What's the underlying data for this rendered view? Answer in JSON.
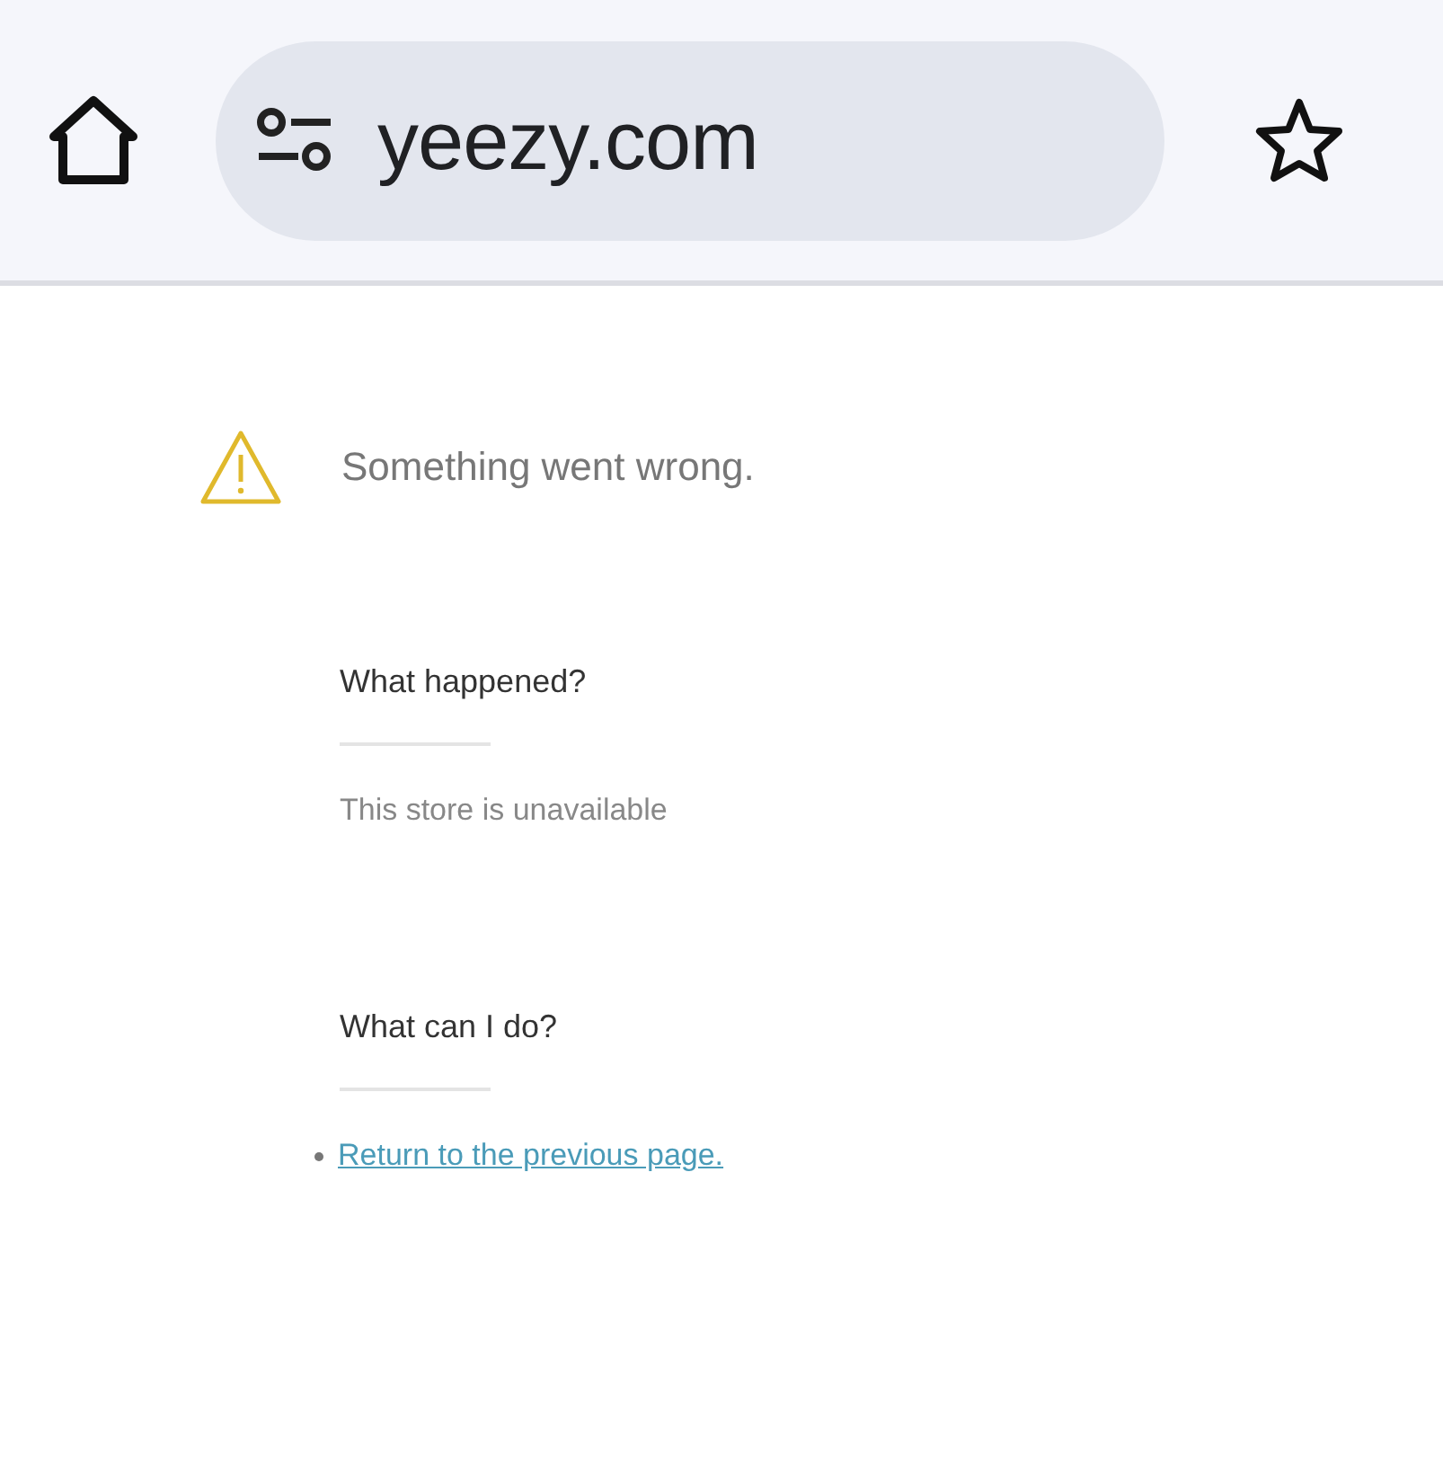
{
  "address_bar": {
    "url": "yeezy.com"
  },
  "error": {
    "message": "Something went wrong."
  },
  "sections": [
    {
      "title": "What happened?",
      "kind": "text",
      "text": "This store is unavailable"
    },
    {
      "title": "What can I do?",
      "kind": "links",
      "links": [
        "Return to the previous page."
      ]
    }
  ]
}
